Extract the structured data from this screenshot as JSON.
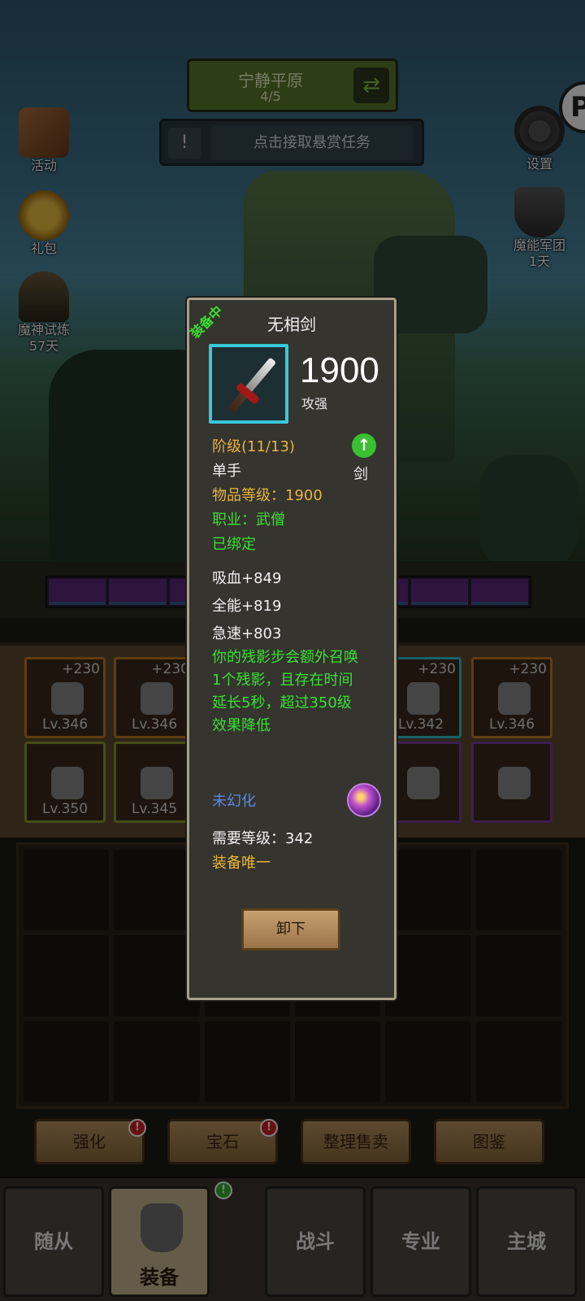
{
  "zone": {
    "name": "宁静平原",
    "progress": "4/5"
  },
  "quest": {
    "alert": "!",
    "text": "点击接取悬赏任务"
  },
  "left_icons": [
    {
      "label": "活动",
      "sub": ""
    },
    {
      "label": "礼包",
      "sub": ""
    },
    {
      "label": "魔神试炼",
      "sub": "57天"
    }
  ],
  "right_icons": [
    {
      "label": "设置",
      "sub": ""
    },
    {
      "label": "魔能军团",
      "sub": "1天"
    }
  ],
  "equip_slots_row1": [
    {
      "plus": "+230",
      "level": "Lv.346"
    },
    {
      "plus": "+230",
      "level": "Lv.346"
    },
    {
      "plus": "+230",
      "level": "Lv.342"
    },
    {
      "plus": "+230",
      "level": "Lv.346"
    }
  ],
  "equip_slots_row2": [
    {
      "level": "Lv.350"
    },
    {
      "level": "Lv.345"
    }
  ],
  "tools": [
    "强化",
    "宝石",
    "整理售卖",
    "图鉴"
  ],
  "nav": [
    "随从",
    "装备",
    "战斗",
    "专业",
    "主城"
  ],
  "tooltip": {
    "equipped_tag": "装备中",
    "name": "无相剑",
    "power": "1900",
    "power_label": "攻强",
    "tier": "阶级(11/13)",
    "hand": "单手",
    "weapon_type": "剑",
    "item_level": "物品等级：1900",
    "class": "职业：武僧",
    "bound": "已绑定",
    "stats": [
      "吸血+849",
      "全能+819",
      "急速+803"
    ],
    "effect": "你的残影步会额外召唤1个残影，且存在时间延长5秒，超过350级效果降低",
    "transmog": "未幻化",
    "required_level": "需要等级：342",
    "unique": "装备唯一",
    "unequip_label": "卸下"
  },
  "colors": {
    "gold_text": "#e8b43a",
    "green_text": "#38e030",
    "blue_text": "#5a8ae0",
    "frame_cyan": "#38c8d8"
  }
}
